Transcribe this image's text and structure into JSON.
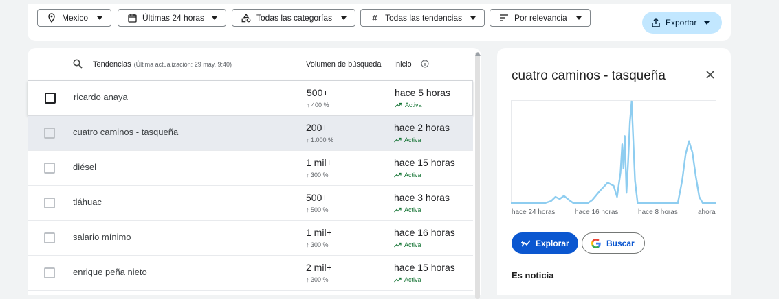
{
  "filters": {
    "location": "Mexico",
    "time": "Últimas 24 horas",
    "category": "Todas las categorías",
    "trends": "Todas las tendencias",
    "sort": "Por relevancia",
    "export": "Exportar"
  },
  "table": {
    "header_trends": "Tendencias",
    "header_updated": "(Última actualización: 29 may, 9:40)",
    "header_volume": "Volumen de búsqueda",
    "header_start": "Inicio",
    "rows": [
      {
        "name": "ricardo anaya",
        "volume": "500+",
        "pct": "↑ 400 %",
        "start": "hace 5 horas",
        "status": "Activa"
      },
      {
        "name": "cuatro caminos - tasqueña",
        "volume": "200+",
        "pct": "↑ 1.000 %",
        "start": "hace 2 horas",
        "status": "Activa"
      },
      {
        "name": "diésel",
        "volume": "1 mil+",
        "pct": "↑ 300 %",
        "start": "hace 15 horas",
        "status": "Activa"
      },
      {
        "name": "tláhuac",
        "volume": "500+",
        "pct": "↑ 500 %",
        "start": "hace 3 horas",
        "status": "Activa"
      },
      {
        "name": "salario mínimo",
        "volume": "1 mil+",
        "pct": "↑ 300 %",
        "start": "hace 16 horas",
        "status": "Activa"
      },
      {
        "name": "enrique peña nieto",
        "volume": "2 mil+",
        "pct": "↑ 300 %",
        "start": "hace 15 horas",
        "status": "Activa"
      }
    ]
  },
  "panel": {
    "title": "cuatro caminos - tasqueña",
    "explore": "Explorar",
    "search": "Buscar",
    "news_heading": "Es noticia",
    "chart_data": {
      "type": "line",
      "x_tick_labels": [
        "hace 24 horas",
        "hace 16 horas",
        "hace 8 horas",
        "ahora"
      ],
      "xlim": [
        24,
        0
      ],
      "ylim": [
        0,
        100
      ],
      "grid": true,
      "color": "#8ecdf0",
      "points": [
        [
          24,
          0
        ],
        [
          23,
          0
        ],
        [
          22,
          0
        ],
        [
          21,
          0
        ],
        [
          20,
          0
        ],
        [
          19.3,
          2
        ],
        [
          18.8,
          6
        ],
        [
          18.3,
          4
        ],
        [
          17.8,
          7
        ],
        [
          17.2,
          3
        ],
        [
          16.7,
          0
        ],
        [
          16,
          0
        ],
        [
          15,
          0
        ],
        [
          14.5,
          3
        ],
        [
          13.6,
          12
        ],
        [
          12.7,
          20
        ],
        [
          12,
          17
        ],
        [
          11.6,
          6
        ],
        [
          11.2,
          30
        ],
        [
          11,
          58
        ],
        [
          10.85,
          34
        ],
        [
          10.7,
          66
        ],
        [
          10.5,
          10
        ],
        [
          10.3,
          42
        ],
        [
          10.1,
          80
        ],
        [
          9.9,
          100
        ],
        [
          9.5,
          22
        ],
        [
          9.2,
          0
        ],
        [
          8,
          0
        ],
        [
          7,
          0
        ],
        [
          6,
          0
        ],
        [
          5,
          0
        ],
        [
          4.5,
          0
        ],
        [
          4,
          22
        ],
        [
          3.6,
          48
        ],
        [
          3.2,
          61
        ],
        [
          2.8,
          50
        ],
        [
          2.4,
          26
        ],
        [
          2,
          6
        ],
        [
          1.6,
          0
        ],
        [
          1,
          0
        ],
        [
          0.5,
          0
        ],
        [
          0,
          0
        ]
      ]
    }
  }
}
